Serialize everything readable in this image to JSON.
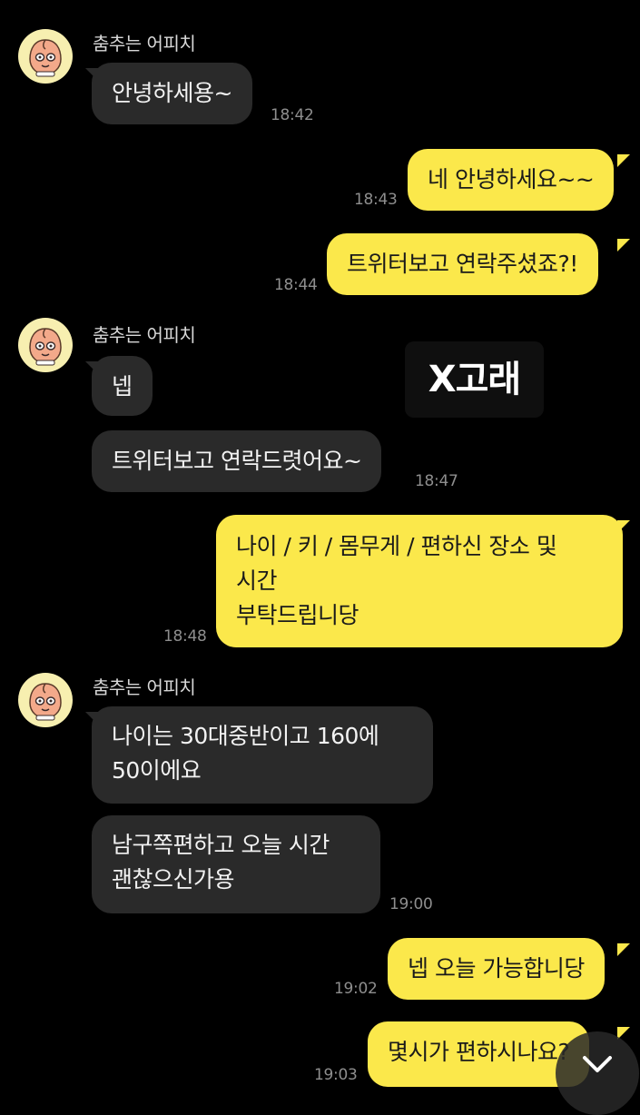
{
  "sender_name": "춤추는 어피치",
  "messages": [
    {
      "text": "안녕하세용~",
      "time": "18:42"
    },
    {
      "text": "네 안녕하세요~~",
      "time": "18:43"
    },
    {
      "text": "트위터보고 연락주셨죠?!",
      "time": "18:44"
    },
    {
      "text": "넵",
      "time": ""
    },
    {
      "text": "트위터보고 연락드렷어요~",
      "time": "18:47"
    },
    {
      "text": "나이 / 키 / 몸무게 / 편하신 장소 및\n시간\n부탁드립니당",
      "time": "18:48"
    },
    {
      "text": "나이는 30대중반이고 160에\n50이에요",
      "time": ""
    },
    {
      "text": "남구쪽편하고 오늘 시간\n괜찮으신가용",
      "time": "19:00"
    },
    {
      "text": "넵 오늘 가능합니당",
      "time": "19:02"
    },
    {
      "text": "몇시가 편하시나요?",
      "time": "19:03"
    }
  ],
  "overlay_text": "X고래",
  "icons": {
    "avatar": "apeach-avatar-icon",
    "scroll": "chevron-down-icon"
  },
  "colors": {
    "background": "#000000",
    "incoming_bubble": "#2a2a2a",
    "outgoing_bubble": "#fbe84b"
  }
}
